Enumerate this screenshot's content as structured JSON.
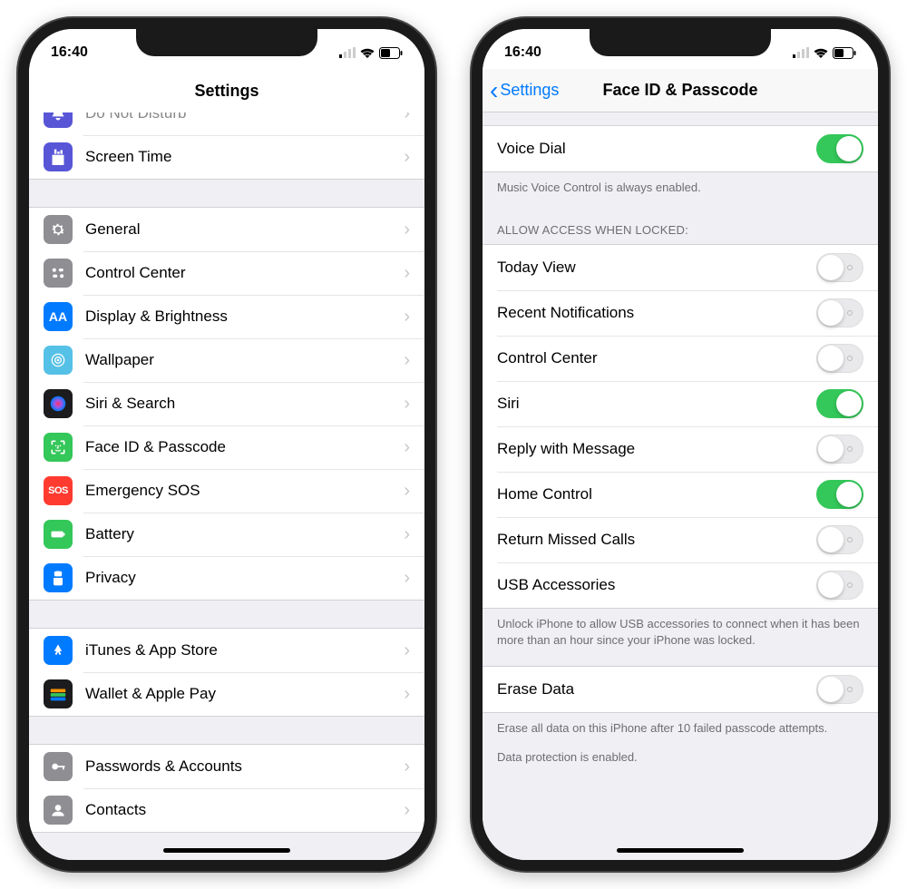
{
  "status": {
    "time": "16:40"
  },
  "left": {
    "title": "Settings",
    "groups": [
      {
        "rows": [
          {
            "icon": "dnd",
            "bg": "#5856d6",
            "label": "Do Not Disturb",
            "cut": true
          },
          {
            "icon": "screentime",
            "bg": "#5856d6",
            "label": "Screen Time"
          }
        ]
      },
      {
        "rows": [
          {
            "icon": "general",
            "bg": "#8e8e93",
            "label": "General"
          },
          {
            "icon": "control",
            "bg": "#8e8e93",
            "label": "Control Center"
          },
          {
            "icon": "display",
            "bg": "#007aff",
            "label": "Display & Brightness"
          },
          {
            "icon": "wallpaper",
            "bg": "#56c1e6",
            "label": "Wallpaper"
          },
          {
            "icon": "siri",
            "bg": "#1c1c1e",
            "label": "Siri & Search"
          },
          {
            "icon": "faceid",
            "bg": "#34c759",
            "label": "Face ID & Passcode"
          },
          {
            "icon": "sos",
            "bg": "#ff3b30",
            "label": "Emergency SOS"
          },
          {
            "icon": "battery",
            "bg": "#34c759",
            "label": "Battery"
          },
          {
            "icon": "privacy",
            "bg": "#007aff",
            "label": "Privacy"
          }
        ]
      },
      {
        "rows": [
          {
            "icon": "appstore",
            "bg": "#007aff",
            "label": "iTunes & App Store"
          },
          {
            "icon": "wallet",
            "bg": "#1c1c1e",
            "label": "Wallet & Apple Pay"
          }
        ]
      },
      {
        "rows": [
          {
            "icon": "passwords",
            "bg": "#8e8e93",
            "label": "Passwords & Accounts"
          },
          {
            "icon": "contacts",
            "bg": "#8e8e93",
            "label": "Contacts",
            "cut": true
          }
        ]
      }
    ]
  },
  "right": {
    "back": "Settings",
    "title": "Face ID & Passcode",
    "voice_dial": {
      "label": "Voice Dial",
      "on": true
    },
    "voice_dial_footer": "Music Voice Control is always enabled.",
    "allow_header": "ALLOW ACCESS WHEN LOCKED:",
    "allow_rows": [
      {
        "label": "Today View",
        "on": false
      },
      {
        "label": "Recent Notifications",
        "on": false
      },
      {
        "label": "Control Center",
        "on": false
      },
      {
        "label": "Siri",
        "on": true
      },
      {
        "label": "Reply with Message",
        "on": false
      },
      {
        "label": "Home Control",
        "on": true
      },
      {
        "label": "Return Missed Calls",
        "on": false
      },
      {
        "label": "USB Accessories",
        "on": false
      }
    ],
    "usb_footer": "Unlock iPhone to allow USB accessories to connect when it has been more than an hour since your iPhone was locked.",
    "erase": {
      "label": "Erase Data",
      "on": false
    },
    "erase_footer1": "Erase all data on this iPhone after 10 failed passcode attempts.",
    "erase_footer2": "Data protection is enabled."
  }
}
